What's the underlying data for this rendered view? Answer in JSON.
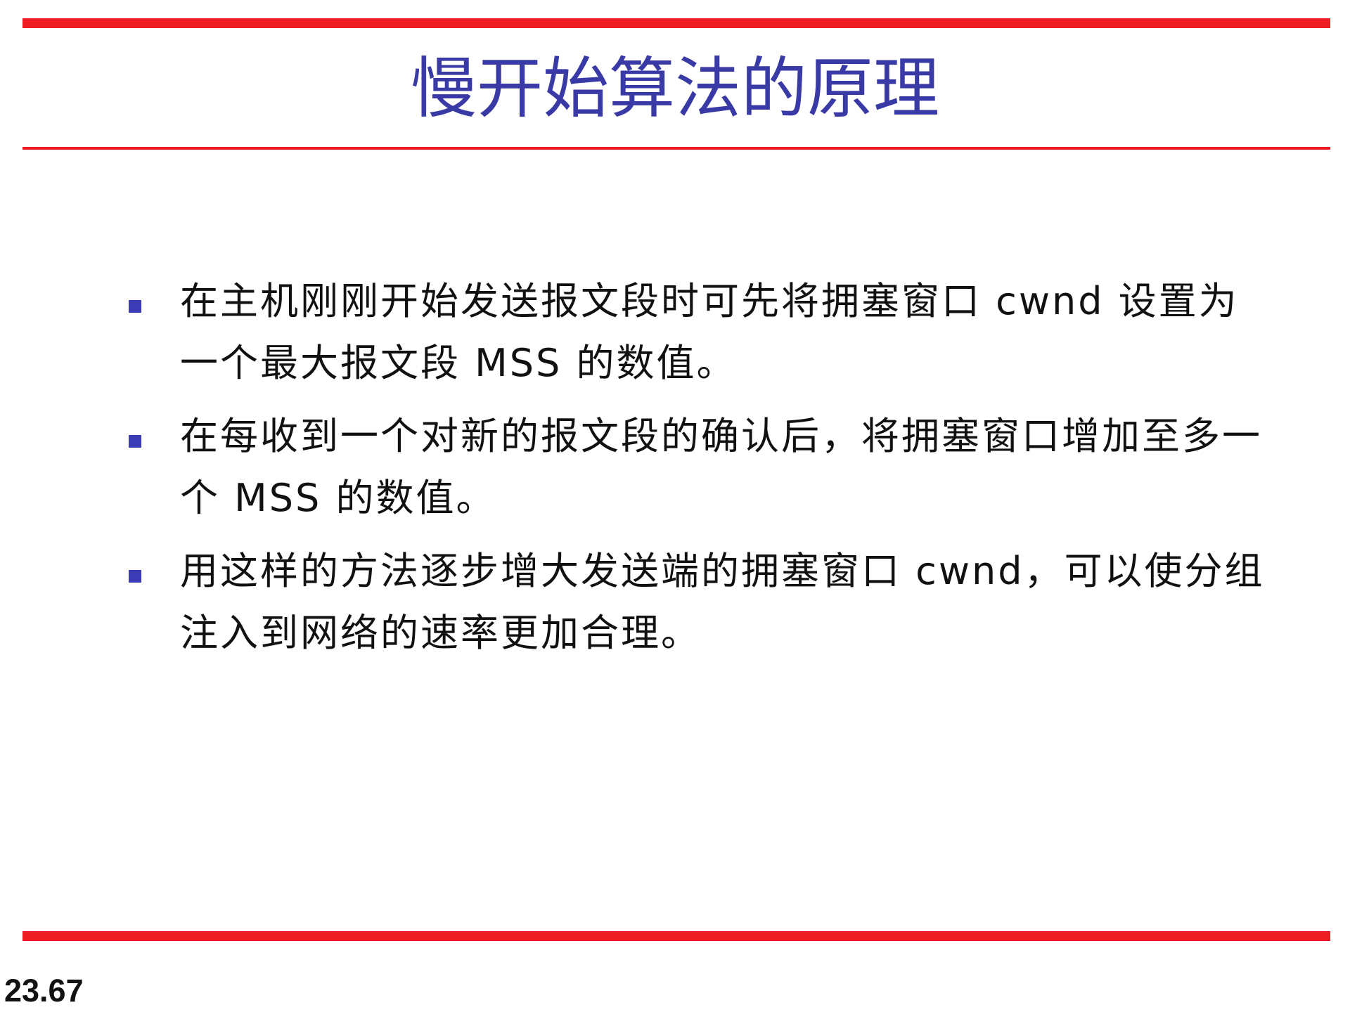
{
  "slide": {
    "title": "慢开始算法的原理",
    "bullets": [
      "在主机刚刚开始发送报文段时可先将拥塞窗口 cwnd 设置为一个最大报文段 MSS 的数值。",
      "在每收到一个对新的报文段的确认后，将拥塞窗口增加至多一个 MSS 的数值。",
      "用这样的方法逐步增大发送端的拥塞窗口 cwnd，可以使分组注入到网络的速率更加合理。"
    ],
    "page_number": "23.67"
  },
  "colors": {
    "rule": "#ee1c25",
    "title": "#3a3aa6",
    "bullet_marker": "#3b3bb8",
    "body_text": "#111111"
  }
}
